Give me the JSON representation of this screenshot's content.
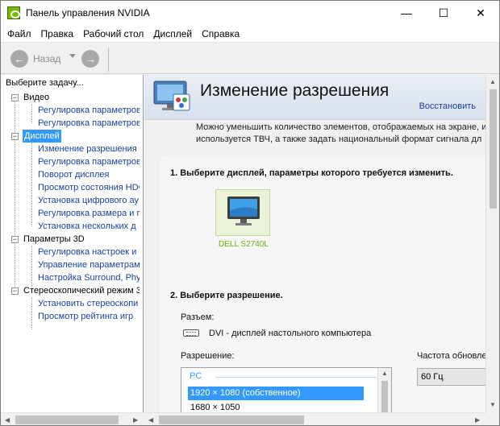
{
  "window": {
    "title": "Панель управления NVIDIA",
    "minimize": "—",
    "maximize": "☐",
    "close": "✕"
  },
  "menu": [
    "Файл",
    "Правка",
    "Рабочий стол",
    "Дисплей",
    "Справка"
  ],
  "toolbar": {
    "back_label": "Назад",
    "back_icon": "back-arrow-icon",
    "forward_icon": "forward-arrow-icon"
  },
  "sidebar": {
    "header": "Выберите задачу...",
    "categories": [
      {
        "label": "Видео",
        "items": [
          "Регулировка параметров",
          "Регулировка параметров"
        ]
      },
      {
        "label": "Дисплей",
        "items": [
          "Изменение разрешения",
          "Регулировка параметров",
          "Поворот дисплея",
          "Просмотр состояния HDC",
          "Установка цифрового ау",
          "Регулировка размера и п",
          "Установка нескольких д"
        ]
      },
      {
        "label": "Параметры 3D",
        "items": [
          "Регулировка настроек и",
          "Управление параметрам",
          "Настройка Surround, Phy"
        ]
      },
      {
        "label": "Стереоскопический режим 3",
        "items": [
          "Установить стереоскопи",
          "Просмотр рейтинга игр"
        ]
      }
    ]
  },
  "main": {
    "title": "Изменение разрешения",
    "restore": "Восстановить",
    "description_line1": "Можно уменьшить количество элементов, отображаемых на экране, и",
    "description_line2": "используется ТВЧ, а также задать национальный формат сигнала дл",
    "step1": "1. Выберите дисплей, параметры которого требуется изменить.",
    "display_name": "DELL S2740L",
    "step2": "2. Выберите разрешение.",
    "connector_label": "Разъем:",
    "connector_value": "DVI - дисплей настольного компьютера",
    "resolution_label": "Разрешение:",
    "frequency_label": "Частота обновле",
    "frequency_value": "60 Гц",
    "resolution_group": "PC",
    "resolutions": [
      "1920 × 1080 (собственное)",
      "1680 × 1050"
    ]
  }
}
